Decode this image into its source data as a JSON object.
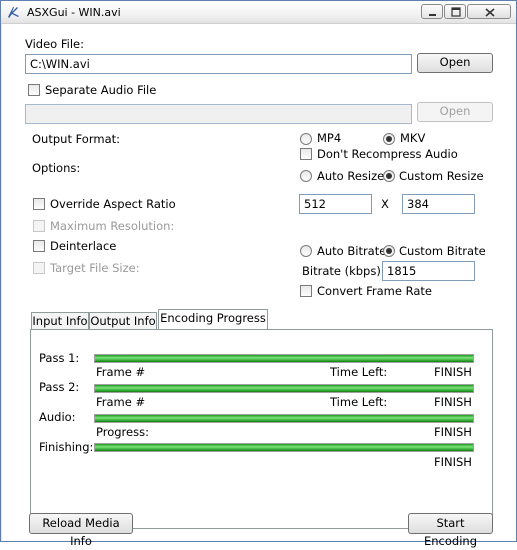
{
  "window": {
    "title": "ASXGui - WIN.avi"
  },
  "video_file": {
    "label": "Video File:",
    "value": "C:\\WIN.avi",
    "open_label": "Open"
  },
  "audio": {
    "separate_label": "Separate Audio File",
    "separate_checked": false,
    "value": "",
    "open_label": "Open"
  },
  "output_format": {
    "label": "Output Format:",
    "mp4": "MP4",
    "mkv": "MKV",
    "selected": "MKV"
  },
  "options": {
    "label": "Options:",
    "dont_recompress_audio": "Don't Recompress Audio",
    "auto_resize": "Auto Resize",
    "custom_resize": "Custom Resize",
    "resize_selected": "Custom Resize",
    "width": "512",
    "x_label": "X",
    "height": "384",
    "override_aspect": "Override Aspect Ratio",
    "max_resolution": "Maximum Resolution:",
    "deinterlace": "Deinterlace",
    "target_size": "Target File Size:",
    "auto_bitrate": "Auto Bitrate",
    "custom_bitrate": "Custom Bitrate",
    "bitrate_selected": "Custom Bitrate",
    "bitrate_label": "Bitrate (kbps):",
    "bitrate_value": "1815",
    "convert_frame_rate": "Convert Frame Rate"
  },
  "tabs": [
    "Input Info",
    "Output Info",
    "Encoding Progress"
  ],
  "active_tab": "Encoding Progress",
  "progress": {
    "pass1": {
      "label": "Pass 1:",
      "left": "Frame #",
      "mid": "Time Left:",
      "right": "FINISH",
      "fraction": 1.0
    },
    "pass2": {
      "label": "Pass 2:",
      "left": "Frame #",
      "mid": "Time Left:",
      "right": "FINISH",
      "fraction": 1.0
    },
    "audio": {
      "label": "Audio:",
      "left": "Progress:",
      "right": "FINISH",
      "fraction": 1.0
    },
    "finishing": {
      "label": "Finishing:",
      "right": "FINISH",
      "fraction": 1.0
    }
  },
  "buttons": {
    "reload": "Reload Media Info",
    "start": "Start Encoding"
  }
}
